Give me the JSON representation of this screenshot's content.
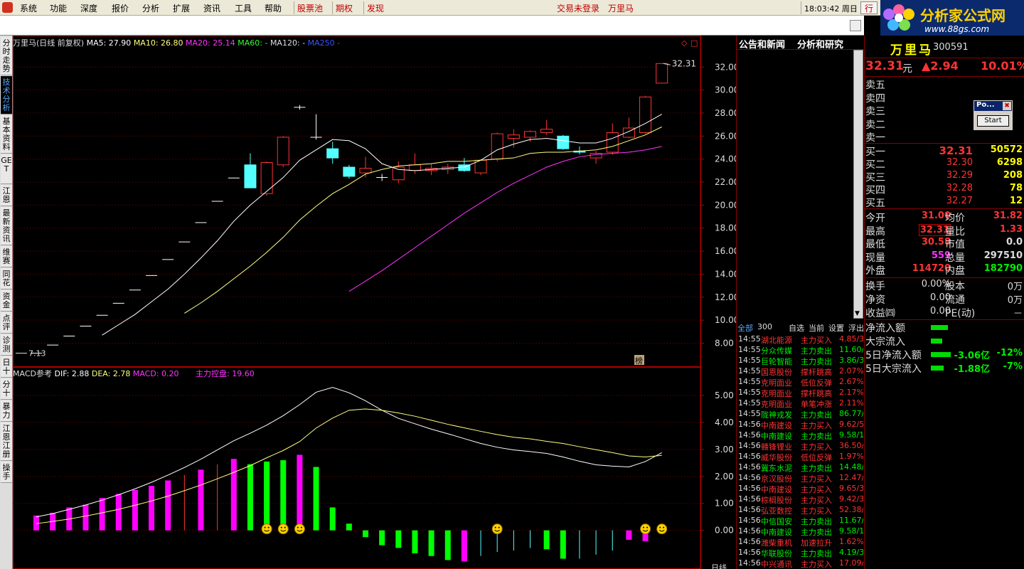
{
  "menubar": {
    "items": [
      "系统",
      "功能",
      "深度",
      "报价",
      "分析",
      "扩展",
      "资讯",
      "工具",
      "帮助"
    ],
    "red_items": [
      "股票池",
      "期权",
      "发现"
    ],
    "status": "交易未登录",
    "stock": "万里马",
    "clock": "18:03:42 周日",
    "mode": "行"
  },
  "logo": {
    "title": "分析家公式网",
    "url": "www.88gs.com"
  },
  "left_tabs": [
    "分时走势",
    "技术分析",
    "基本资料",
    "GET",
    "江恩",
    "最新资讯",
    "维赛",
    "同花",
    "资金",
    "点评",
    "诊测",
    "日十",
    "分十",
    "暴力",
    "江恩江册",
    "操手"
  ],
  "chart_header": {
    "name": "万里马(日线 前复权)",
    "ma5": "MA5: 27.90",
    "ma10": "MA10: 26.80",
    "ma20": "MA20: 25.14",
    "ma60": "MA60: -",
    "ma120": "MA120: -",
    "ma250": "MA250  -"
  },
  "macd_header": {
    "name": "MACD参考",
    "dif": "DIF: 2.88",
    "dea": "DEA: 2.78",
    "macd": "MACD: 0.20",
    "ctrl": "主力控盘: 19.60"
  },
  "price_axis": [
    "32.00",
    "30.00",
    "28.00",
    "26.00",
    "24.00",
    "22.00",
    "20.00",
    "18.00",
    "16.00",
    "14.00",
    "12.00",
    "10.00",
    "8.00"
  ],
  "macd_axis": [
    "5.00",
    "4.00",
    "3.00",
    "2.00",
    "1.00",
    "0.00"
  ],
  "chart_labels": {
    "high": "32.31",
    "low": "7.13",
    "rank": "榜",
    "day": "日线"
  },
  "colors": {
    "up": "#ff3333",
    "down": "#54ffff",
    "ma5": "#ffffff",
    "ma10": "#ffff80",
    "ma20": "#ff33ff",
    "ma60": "#33ff33",
    "ma250": "#3333ff",
    "axis": "#b00000"
  },
  "candles": [
    {
      "o": 7.13,
      "c": 7.13,
      "h": 7.13,
      "l": 7.13
    },
    {
      "o": 7.84,
      "c": 7.84,
      "h": 7.84,
      "l": 7.84
    },
    {
      "o": 8.62,
      "c": 8.62,
      "h": 8.62,
      "l": 8.62
    },
    {
      "o": 9.48,
      "c": 9.48,
      "h": 9.48,
      "l": 9.48
    },
    {
      "o": 10.43,
      "c": 10.43,
      "h": 10.43,
      "l": 10.43
    },
    {
      "o": 11.47,
      "c": 11.47,
      "h": 11.47,
      "l": 11.47
    },
    {
      "o": 12.62,
      "c": 12.62,
      "h": 12.62,
      "l": 12.62
    },
    {
      "o": 13.88,
      "c": 13.88,
      "h": 13.88,
      "l": 13.88
    },
    {
      "o": 15.27,
      "c": 15.27,
      "h": 15.27,
      "l": 15.27
    },
    {
      "o": 16.8,
      "c": 16.8,
      "h": 16.8,
      "l": 16.8
    },
    {
      "o": 18.48,
      "c": 18.48,
      "h": 18.48,
      "l": 18.48
    },
    {
      "o": 20.33,
      "c": 20.33,
      "h": 20.33,
      "l": 20.33
    },
    {
      "o": 22.36,
      "c": 22.36,
      "h": 22.36,
      "l": 22.36
    },
    {
      "o": 23.5,
      "c": 21.5,
      "h": 24.5,
      "l": 21.5
    },
    {
      "o": 21.0,
      "c": 23.7,
      "h": 23.8,
      "l": 20.8
    },
    {
      "o": 23.5,
      "c": 25.9,
      "h": 26.0,
      "l": 23.3
    },
    {
      "o": 28.5,
      "c": 28.5,
      "h": 28.7,
      "l": 28.3
    },
    {
      "o": 25.9,
      "c": 25.9,
      "h": 27.9,
      "l": 25.7
    },
    {
      "o": 24.9,
      "c": 24.1,
      "h": 25.5,
      "l": 23.6
    },
    {
      "o": 23.3,
      "c": 22.5,
      "h": 23.5,
      "l": 22.3
    },
    {
      "o": 22.8,
      "c": 23.2,
      "h": 24.2,
      "l": 22.4
    },
    {
      "o": 22.4,
      "c": 22.4,
      "h": 22.7,
      "l": 22.1
    },
    {
      "o": 22.2,
      "c": 23.3,
      "h": 23.8,
      "l": 21.9
    },
    {
      "o": 23.0,
      "c": 23.5,
      "h": 24.5,
      "l": 22.7
    },
    {
      "o": 23.0,
      "c": 23.2,
      "h": 23.6,
      "l": 22.6
    },
    {
      "o": 23.1,
      "c": 23.3,
      "h": 23.6,
      "l": 22.7
    },
    {
      "o": 23.5,
      "c": 23.0,
      "h": 24.1,
      "l": 22.9
    },
    {
      "o": 22.8,
      "c": 23.9,
      "h": 24.0,
      "l": 22.6
    },
    {
      "o": 24.0,
      "c": 26.2,
      "h": 26.3,
      "l": 23.8
    },
    {
      "o": 25.8,
      "c": 26.1,
      "h": 26.6,
      "l": 25.0
    },
    {
      "o": 25.9,
      "c": 26.4,
      "h": 26.5,
      "l": 25.5
    },
    {
      "o": 26.3,
      "c": 26.6,
      "h": 27.4,
      "l": 26.1
    },
    {
      "o": 26.0,
      "c": 24.9,
      "h": 26.1,
      "l": 24.8
    },
    {
      "o": 24.7,
      "c": 24.6,
      "h": 25.1,
      "l": 24.4
    },
    {
      "o": 24.1,
      "c": 24.5,
      "h": 24.7,
      "l": 23.6
    },
    {
      "o": 24.6,
      "c": 26.3,
      "h": 27.1,
      "l": 24.4
    },
    {
      "o": 25.9,
      "c": 26.7,
      "h": 27.6,
      "l": 25.8
    },
    {
      "o": 26.3,
      "c": 29.4,
      "h": 29.5,
      "l": 26.2
    },
    {
      "o": 30.6,
      "c": 32.31,
      "h": 32.35,
      "l": 30.58
    }
  ],
  "ma_lines": {
    "ma5": [
      null,
      null,
      null,
      null,
      8.7,
      9.6,
      10.5,
      11.6,
      12.7,
      14.0,
      15.4,
      16.9,
      18.6,
      20.0,
      21.2,
      22.4,
      23.9,
      24.8,
      25.7,
      25.6,
      24.9,
      23.6,
      23.1,
      23.0,
      23.1,
      23.2,
      23.3,
      23.9,
      24.8,
      25.3,
      25.7,
      25.8,
      25.6,
      25.4,
      25.4,
      25.8,
      26.4,
      27.1,
      27.9
    ],
    "ma10": [
      null,
      null,
      null,
      null,
      null,
      null,
      null,
      null,
      null,
      10.6,
      11.5,
      12.5,
      13.6,
      14.7,
      15.9,
      17.2,
      18.7,
      19.9,
      21.0,
      21.8,
      22.7,
      23.1,
      23.4,
      23.5,
      23.6,
      23.8,
      23.8,
      23.9,
      24.0,
      24.1,
      24.5,
      24.6,
      24.6,
      24.7,
      24.8,
      25.1,
      25.6,
      26.1,
      26.8
    ],
    "ma20": [
      null,
      null,
      null,
      null,
      null,
      null,
      null,
      null,
      null,
      null,
      null,
      null,
      null,
      null,
      null,
      null,
      null,
      null,
      null,
      12.5,
      13.4,
      14.3,
      15.3,
      16.3,
      17.3,
      18.3,
      19.3,
      20.2,
      21.1,
      21.9,
      22.6,
      23.3,
      23.8,
      24.2,
      24.4,
      24.5,
      24.6,
      24.8,
      25.1
    ]
  },
  "macd": {
    "dif": [
      0.5,
      0.62,
      0.78,
      0.94,
      1.12,
      1.32,
      1.54,
      1.78,
      2.05,
      2.33,
      2.64,
      2.98,
      3.32,
      3.6,
      3.9,
      4.25,
      4.66,
      5.12,
      5.3,
      5.1,
      4.8,
      4.45,
      4.15,
      3.95,
      3.75,
      3.58,
      3.4,
      3.22,
      3.08,
      2.98,
      2.92,
      2.85,
      2.72,
      2.56,
      2.43,
      2.38,
      2.35,
      2.55,
      2.88
    ],
    "dea": [
      0.25,
      0.33,
      0.42,
      0.53,
      0.65,
      0.78,
      0.93,
      1.09,
      1.27,
      1.47,
      1.68,
      1.91,
      2.15,
      2.4,
      2.69,
      2.96,
      3.29,
      3.79,
      4.16,
      4.45,
      4.5,
      4.45,
      4.35,
      4.23,
      4.08,
      3.93,
      3.8,
      3.67,
      3.55,
      3.45,
      3.39,
      3.3,
      3.22,
      3.1,
      2.99,
      2.88,
      2.76,
      2.72,
      2.78
    ],
    "bars": [
      0.55,
      0.65,
      0.85,
      0.95,
      1.2,
      1.35,
      1.5,
      1.65,
      1.85,
      2.05,
      2.25,
      2.45,
      2.65,
      2.45,
      2.55,
      2.6,
      2.8,
      2.35,
      0.85,
      0.25,
      -0.25,
      -0.55,
      -0.65,
      -0.85,
      -0.95,
      -1.1,
      -1.15,
      -0.95,
      -0.8,
      -0.75,
      -0.65,
      -0.7,
      -1.05,
      -1.05,
      -0.9,
      -0.75,
      -0.35,
      -0.4,
      0.2
    ],
    "bar_colors": [
      "m",
      "m",
      "m",
      "m",
      "m",
      "m",
      "m",
      "m",
      "m",
      "r",
      "m",
      "r",
      "m",
      "g",
      "g",
      "g",
      "m",
      "g",
      "g",
      "g",
      "g",
      "g",
      "g",
      "g",
      "g",
      "g",
      "m",
      "c",
      "c",
      "c",
      "c",
      "g",
      "g",
      "c",
      "c",
      "c",
      "m",
      "m",
      "m"
    ],
    "smiley_days": [
      14,
      15,
      16,
      28,
      37,
      38
    ]
  },
  "news_panel": {
    "tabs": [
      "公告和新闻",
      "分析和研究"
    ],
    "list_tabs": [
      "全部",
      "300",
      "自选",
      "当前",
      "设置",
      "浮出",
      "点"
    ],
    "rows": [
      {
        "t": "14:55",
        "n": "湖北能源",
        "a": "主力买入",
        "v": "4.85/3",
        "c": "r"
      },
      {
        "t": "14:55",
        "n": "分众传媒",
        "a": "主力卖出",
        "v": "11.60/",
        "c": "g"
      },
      {
        "t": "14:55",
        "n": "巨轮智能",
        "a": "主力卖出",
        "v": "3.86/3",
        "c": "g"
      },
      {
        "t": "14:55",
        "n": "国恩股份",
        "a": "撑杆跳高",
        "v": "2.07%",
        "c": "r"
      },
      {
        "t": "14:55",
        "n": "克明面业",
        "a": "低位反弹",
        "v": "2.67%",
        "c": "r"
      },
      {
        "t": "14:55",
        "n": "克明面业",
        "a": "撑杆跳高",
        "v": "2.17%",
        "c": "r"
      },
      {
        "t": "14:55",
        "n": "克明面业",
        "a": "单笔冲涨",
        "v": "2.11%",
        "c": "r"
      },
      {
        "t": "14:55",
        "n": "陇神戎发",
        "a": "主力卖出",
        "v": "86.77/",
        "c": "g"
      },
      {
        "t": "14:56",
        "n": "中南建设",
        "a": "主力买入",
        "v": "9.62/5",
        "c": "r"
      },
      {
        "t": "14:56",
        "n": "中南建设",
        "a": "主力卖出",
        "v": "9.58/1",
        "c": "g"
      },
      {
        "t": "14:56",
        "n": "赣锋锂业",
        "a": "主力买入",
        "v": "36.50/",
        "c": "r"
      },
      {
        "t": "14:56",
        "n": "威华股份",
        "a": "低位反弹",
        "v": "1.97%",
        "c": "r"
      },
      {
        "t": "14:56",
        "n": "冀东水泥",
        "a": "主力卖出",
        "v": "14.48/",
        "c": "g"
      },
      {
        "t": "14:56",
        "n": "京汉股份",
        "a": "主力买入",
        "v": "12.47/",
        "c": "r"
      },
      {
        "t": "14:56",
        "n": "中南建设",
        "a": "主力买入",
        "v": "9.65/3",
        "c": "r"
      },
      {
        "t": "14:56",
        "n": "棕榈股份",
        "a": "主力买入",
        "v": "9.42/3",
        "c": "r"
      },
      {
        "t": "14:56",
        "n": "弘亚数控",
        "a": "主力买入",
        "v": "52.38/",
        "c": "r"
      },
      {
        "t": "14:56",
        "n": "中信国安",
        "a": "主力卖出",
        "v": "11.67/",
        "c": "g"
      },
      {
        "t": "14:56",
        "n": "中南建设",
        "a": "主力卖出",
        "v": "9.58/1",
        "c": "g"
      },
      {
        "t": "14:56",
        "n": "潍柴重机",
        "a": "加速拉升",
        "v": "1.62%",
        "c": "r"
      },
      {
        "t": "14:56",
        "n": "华联股份",
        "a": "主力卖出",
        "v": "4.19/3",
        "c": "g"
      },
      {
        "t": "14:56",
        "n": "中兴通讯",
        "a": "主力买入",
        "v": "17.09/",
        "c": "r"
      }
    ]
  },
  "quote": {
    "name": "万里马",
    "code": "300591",
    "price": "32.31",
    "unit": "元",
    "change": "▲2.94",
    "pct": "10.01%",
    "sell_labels": [
      "卖五",
      "卖四",
      "卖三",
      "卖二",
      "卖一"
    ],
    "buys": [
      {
        "l": "买一",
        "p": "32.31",
        "v": "50572"
      },
      {
        "l": "买二",
        "p": "32.30",
        "v": "6298"
      },
      {
        "l": "买三",
        "p": "32.29",
        "v": "208"
      },
      {
        "l": "买四",
        "p": "32.28",
        "v": "78"
      },
      {
        "l": "买五",
        "p": "32.27",
        "v": "12"
      }
    ],
    "stats": [
      {
        "l1": "今开",
        "v1": "31.00",
        "l2": "均价",
        "v2": "31.82",
        "c1": "r",
        "c2": "r"
      },
      {
        "l1": "最高",
        "v1": "32.31",
        "l2": "量比",
        "v2": "1.33",
        "c1": "r",
        "c2": "r"
      },
      {
        "l1": "最低",
        "v1": "30.58",
        "l2": "市值",
        "v2": "0.0",
        "c1": "r",
        "c2": "w"
      },
      {
        "l1": "现量",
        "v1": "559",
        "l2": "总量",
        "v2": "297510",
        "c1": "m",
        "c2": "w"
      },
      {
        "l1": "外盘",
        "v1": "114720",
        "l2": "内盘",
        "v2": "182790",
        "c1": "r",
        "c2": "g"
      }
    ],
    "stats2": [
      {
        "l1": "换手",
        "v1": "0.00%",
        "l2": "股本",
        "v2": "0万"
      },
      {
        "l1": "净资",
        "v1": "0.00",
        "l2": "流通",
        "v2": "0万"
      },
      {
        "l1": "收益㈣",
        "v1": "0.00",
        "l2": "PE(动)",
        "v2": "－"
      }
    ],
    "flows": [
      {
        "l": "净流入额",
        "v": "",
        "p": ""
      },
      {
        "l": "大宗流入",
        "v": "",
        "p": ""
      },
      {
        "l": "5日净流入额",
        "v": "-3.06亿",
        "p": "-12%"
      },
      {
        "l": "5日大宗流入",
        "v": "-1.88亿",
        "p": "-7%"
      }
    ]
  },
  "popup": {
    "title": "Po...",
    "close": "✖",
    "button": "Start"
  }
}
